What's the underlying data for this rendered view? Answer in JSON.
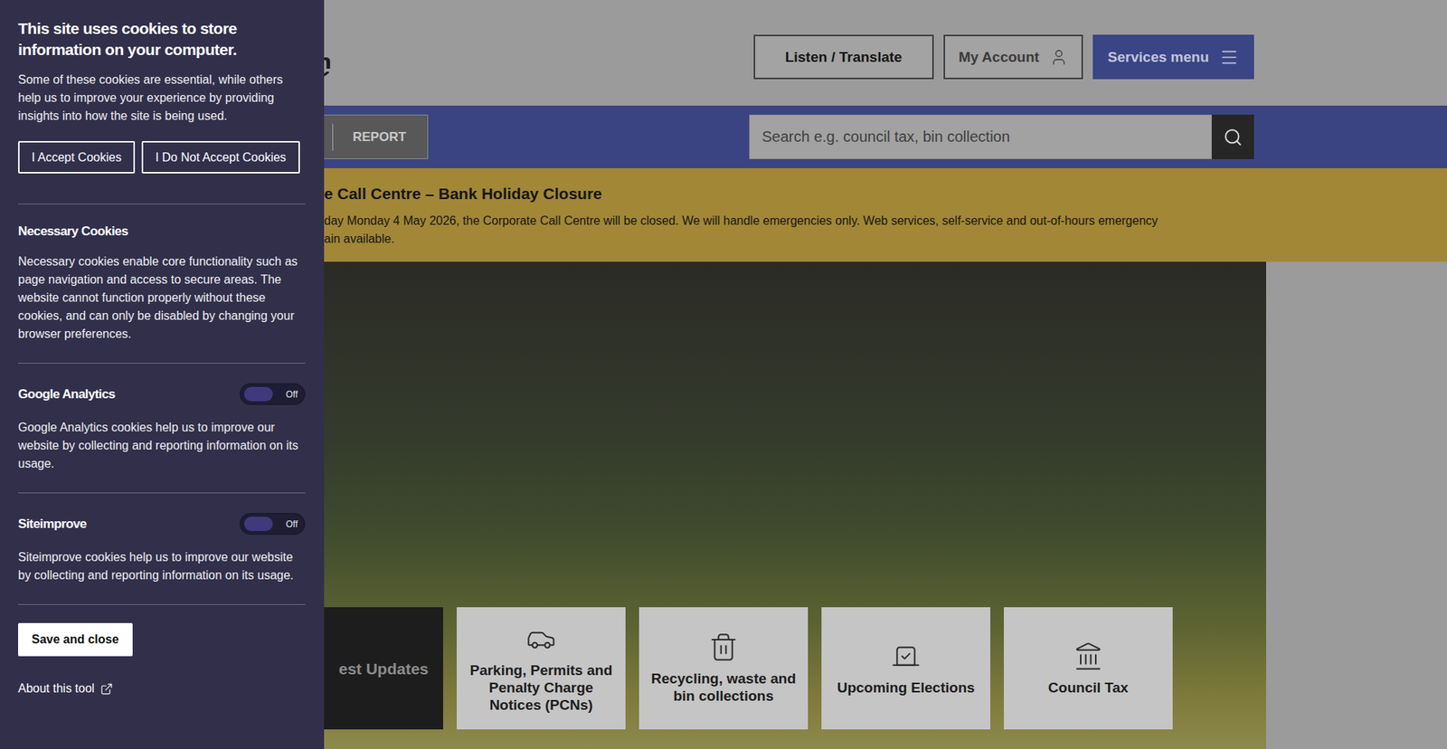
{
  "cookie_panel": {
    "title": "This site uses cookies to store information on your computer.",
    "intro": "Some of these cookies are essential, while others help us to improve your experience by providing insights into how the site is being used.",
    "buttons": [
      {
        "label": "I Accept Cookies"
      },
      {
        "label": "I Do Not Accept Cookies"
      }
    ],
    "categories": [
      {
        "name": "Necessary Cookies",
        "kind": "info",
        "description": "Necessary cookies enable core functionality such as page navigation and access to secure areas. The website cannot function properly without these cookies, and can only be disabled by changing your browser preferences."
      },
      {
        "name": "Google Analytics",
        "kind": "toggle",
        "on": false,
        "state_label": "Off",
        "description": "Google Analytics cookies help us to improve our website by collecting and reporting information on its usage."
      },
      {
        "name": "Siteimprove",
        "kind": "toggle",
        "on": false,
        "state_label": "Off",
        "description": "Siteimprove cookies help us to improve our website by collecting and reporting information on its usage."
      }
    ],
    "save_button": "Save and close",
    "about_link": "About this tool"
  },
  "header": {
    "logo_text": "don",
    "buttons": [
      {
        "label": "Listen / Translate",
        "kind": "plain"
      },
      {
        "label": "My Account",
        "kind": "account"
      },
      {
        "label": "Services menu",
        "kind": "menu"
      }
    ]
  },
  "nav": {
    "tabs": [
      {
        "label": "REPORT",
        "selected": false
      }
    ]
  },
  "search": {
    "placeholder": "Search e.g. council tax, bin collection"
  },
  "alert": {
    "title": "e Call Centre – Bank Holiday Closure",
    "lines": [
      "day Monday 4 May 2026, the Corporate Call Centre will be closed. We will handle emergencies only. Web services, self-service and out-of-hours emergency",
      "ain available."
    ]
  },
  "tiles": [
    {
      "label": "est Updates",
      "kind": "dark"
    },
    {
      "label": "Parking, Permits and Penalty Charge Notices (PCNs)",
      "kind": "parking"
    },
    {
      "label": "Recycling, waste and bin collections",
      "kind": "waste"
    },
    {
      "label": "Upcoming Elections",
      "kind": "elections"
    },
    {
      "label": "Council Tax",
      "kind": "tax"
    }
  ]
}
